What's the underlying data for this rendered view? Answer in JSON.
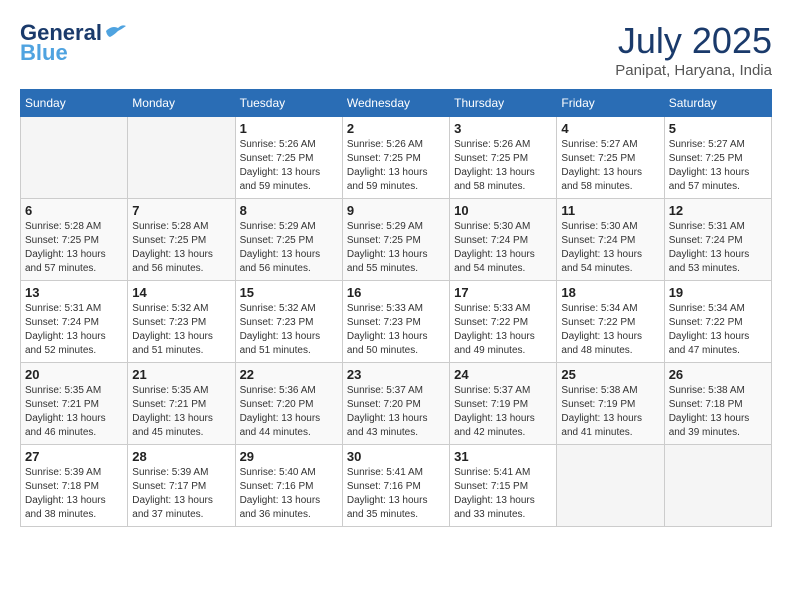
{
  "header": {
    "logo_general": "General",
    "logo_blue": "Blue",
    "month_title": "July 2025",
    "location": "Panipat, Haryana, India"
  },
  "weekdays": [
    "Sunday",
    "Monday",
    "Tuesday",
    "Wednesday",
    "Thursday",
    "Friday",
    "Saturday"
  ],
  "weeks": [
    [
      {
        "day": "",
        "info": ""
      },
      {
        "day": "",
        "info": ""
      },
      {
        "day": "1",
        "info": "Sunrise: 5:26 AM\nSunset: 7:25 PM\nDaylight: 13 hours\nand 59 minutes."
      },
      {
        "day": "2",
        "info": "Sunrise: 5:26 AM\nSunset: 7:25 PM\nDaylight: 13 hours\nand 59 minutes."
      },
      {
        "day": "3",
        "info": "Sunrise: 5:26 AM\nSunset: 7:25 PM\nDaylight: 13 hours\nand 58 minutes."
      },
      {
        "day": "4",
        "info": "Sunrise: 5:27 AM\nSunset: 7:25 PM\nDaylight: 13 hours\nand 58 minutes."
      },
      {
        "day": "5",
        "info": "Sunrise: 5:27 AM\nSunset: 7:25 PM\nDaylight: 13 hours\nand 57 minutes."
      }
    ],
    [
      {
        "day": "6",
        "info": "Sunrise: 5:28 AM\nSunset: 7:25 PM\nDaylight: 13 hours\nand 57 minutes."
      },
      {
        "day": "7",
        "info": "Sunrise: 5:28 AM\nSunset: 7:25 PM\nDaylight: 13 hours\nand 56 minutes."
      },
      {
        "day": "8",
        "info": "Sunrise: 5:29 AM\nSunset: 7:25 PM\nDaylight: 13 hours\nand 56 minutes."
      },
      {
        "day": "9",
        "info": "Sunrise: 5:29 AM\nSunset: 7:25 PM\nDaylight: 13 hours\nand 55 minutes."
      },
      {
        "day": "10",
        "info": "Sunrise: 5:30 AM\nSunset: 7:24 PM\nDaylight: 13 hours\nand 54 minutes."
      },
      {
        "day": "11",
        "info": "Sunrise: 5:30 AM\nSunset: 7:24 PM\nDaylight: 13 hours\nand 54 minutes."
      },
      {
        "day": "12",
        "info": "Sunrise: 5:31 AM\nSunset: 7:24 PM\nDaylight: 13 hours\nand 53 minutes."
      }
    ],
    [
      {
        "day": "13",
        "info": "Sunrise: 5:31 AM\nSunset: 7:24 PM\nDaylight: 13 hours\nand 52 minutes."
      },
      {
        "day": "14",
        "info": "Sunrise: 5:32 AM\nSunset: 7:23 PM\nDaylight: 13 hours\nand 51 minutes."
      },
      {
        "day": "15",
        "info": "Sunrise: 5:32 AM\nSunset: 7:23 PM\nDaylight: 13 hours\nand 51 minutes."
      },
      {
        "day": "16",
        "info": "Sunrise: 5:33 AM\nSunset: 7:23 PM\nDaylight: 13 hours\nand 50 minutes."
      },
      {
        "day": "17",
        "info": "Sunrise: 5:33 AM\nSunset: 7:22 PM\nDaylight: 13 hours\nand 49 minutes."
      },
      {
        "day": "18",
        "info": "Sunrise: 5:34 AM\nSunset: 7:22 PM\nDaylight: 13 hours\nand 48 minutes."
      },
      {
        "day": "19",
        "info": "Sunrise: 5:34 AM\nSunset: 7:22 PM\nDaylight: 13 hours\nand 47 minutes."
      }
    ],
    [
      {
        "day": "20",
        "info": "Sunrise: 5:35 AM\nSunset: 7:21 PM\nDaylight: 13 hours\nand 46 minutes."
      },
      {
        "day": "21",
        "info": "Sunrise: 5:35 AM\nSunset: 7:21 PM\nDaylight: 13 hours\nand 45 minutes."
      },
      {
        "day": "22",
        "info": "Sunrise: 5:36 AM\nSunset: 7:20 PM\nDaylight: 13 hours\nand 44 minutes."
      },
      {
        "day": "23",
        "info": "Sunrise: 5:37 AM\nSunset: 7:20 PM\nDaylight: 13 hours\nand 43 minutes."
      },
      {
        "day": "24",
        "info": "Sunrise: 5:37 AM\nSunset: 7:19 PM\nDaylight: 13 hours\nand 42 minutes."
      },
      {
        "day": "25",
        "info": "Sunrise: 5:38 AM\nSunset: 7:19 PM\nDaylight: 13 hours\nand 41 minutes."
      },
      {
        "day": "26",
        "info": "Sunrise: 5:38 AM\nSunset: 7:18 PM\nDaylight: 13 hours\nand 39 minutes."
      }
    ],
    [
      {
        "day": "27",
        "info": "Sunrise: 5:39 AM\nSunset: 7:18 PM\nDaylight: 13 hours\nand 38 minutes."
      },
      {
        "day": "28",
        "info": "Sunrise: 5:39 AM\nSunset: 7:17 PM\nDaylight: 13 hours\nand 37 minutes."
      },
      {
        "day": "29",
        "info": "Sunrise: 5:40 AM\nSunset: 7:16 PM\nDaylight: 13 hours\nand 36 minutes."
      },
      {
        "day": "30",
        "info": "Sunrise: 5:41 AM\nSunset: 7:16 PM\nDaylight: 13 hours\nand 35 minutes."
      },
      {
        "day": "31",
        "info": "Sunrise: 5:41 AM\nSunset: 7:15 PM\nDaylight: 13 hours\nand 33 minutes."
      },
      {
        "day": "",
        "info": ""
      },
      {
        "day": "",
        "info": ""
      }
    ]
  ]
}
